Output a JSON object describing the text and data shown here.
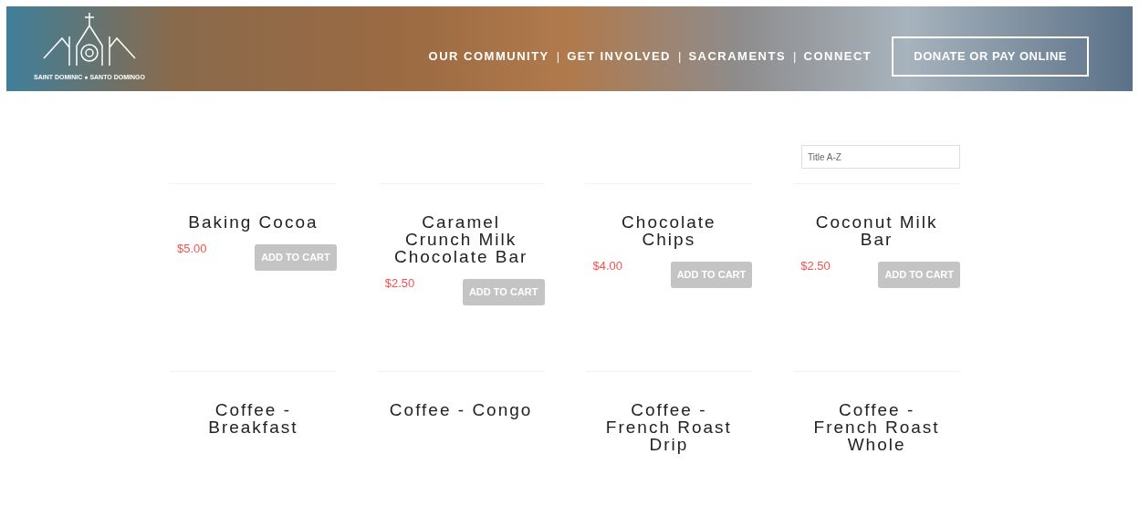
{
  "header": {
    "logo_text": "SAINT DOMINIC ● SANTO DOMINGO",
    "nav": [
      {
        "label": "OUR COMMUNITY"
      },
      {
        "label": "GET INVOLVED"
      },
      {
        "label": "SACRAMENTS"
      },
      {
        "label": "CONNECT"
      }
    ],
    "separator": "|",
    "donate_button": "DONATE OR PAY ONLINE"
  },
  "sort": {
    "placeholder": "Title A-Z"
  },
  "products": [
    {
      "name": "Baking Cocoa",
      "price": "$5.00",
      "button": "ADD TO CART"
    },
    {
      "name": "Caramel Crunch Milk Chocolate Bar",
      "price": "$2.50",
      "button": "ADD TO CART"
    },
    {
      "name": "Chocolate Chips",
      "price": "$4.00",
      "button": "ADD TO CART"
    },
    {
      "name": "Coconut Milk Bar",
      "price": "$2.50",
      "button": "ADD TO CART"
    },
    {
      "name": "Coffee - Breakfast"
    },
    {
      "name": "Coffee - Congo"
    },
    {
      "name": "Coffee - French Roast Drip"
    },
    {
      "name": "Coffee - French Roast Whole"
    }
  ]
}
